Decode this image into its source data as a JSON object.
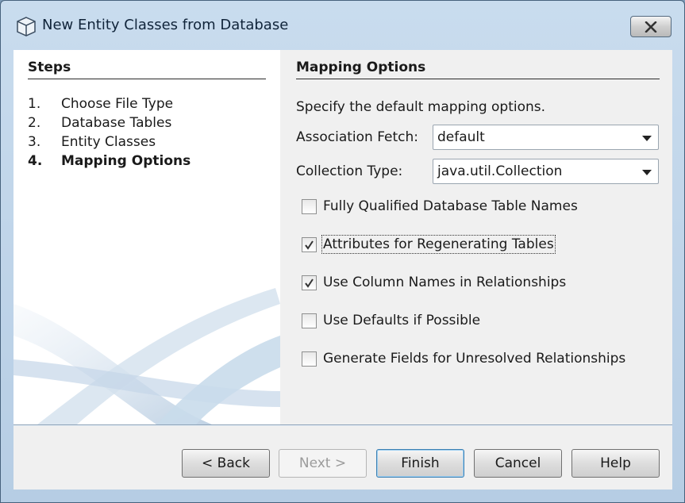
{
  "window": {
    "title": "New Entity Classes from Database",
    "close_icon": "close-icon"
  },
  "steps": {
    "title": "Steps",
    "items": [
      {
        "num": "1.",
        "label": "Choose File Type"
      },
      {
        "num": "2.",
        "label": "Database Tables"
      },
      {
        "num": "3.",
        "label": "Entity Classes"
      },
      {
        "num": "4.",
        "label": "Mapping Options",
        "current": true
      }
    ]
  },
  "mapping": {
    "title": "Mapping Options",
    "intro": "Specify the default mapping options.",
    "association_fetch": {
      "label": "Association Fetch:",
      "value": "default"
    },
    "collection_type": {
      "label": "Collection Type:",
      "value": "java.util.Collection"
    },
    "options": [
      {
        "label": "Fully Qualified Database Table Names",
        "checked": false
      },
      {
        "label": "Attributes for Regenerating Tables",
        "checked": true
      },
      {
        "label": "Use Column Names in Relationships",
        "checked": true
      },
      {
        "label": "Use Defaults if Possible",
        "checked": false
      },
      {
        "label": "Generate Fields for Unresolved Relationships",
        "checked": false
      }
    ]
  },
  "buttons": {
    "back": "< Back",
    "next": "Next >",
    "finish": "Finish",
    "cancel": "Cancel",
    "help": "Help"
  }
}
